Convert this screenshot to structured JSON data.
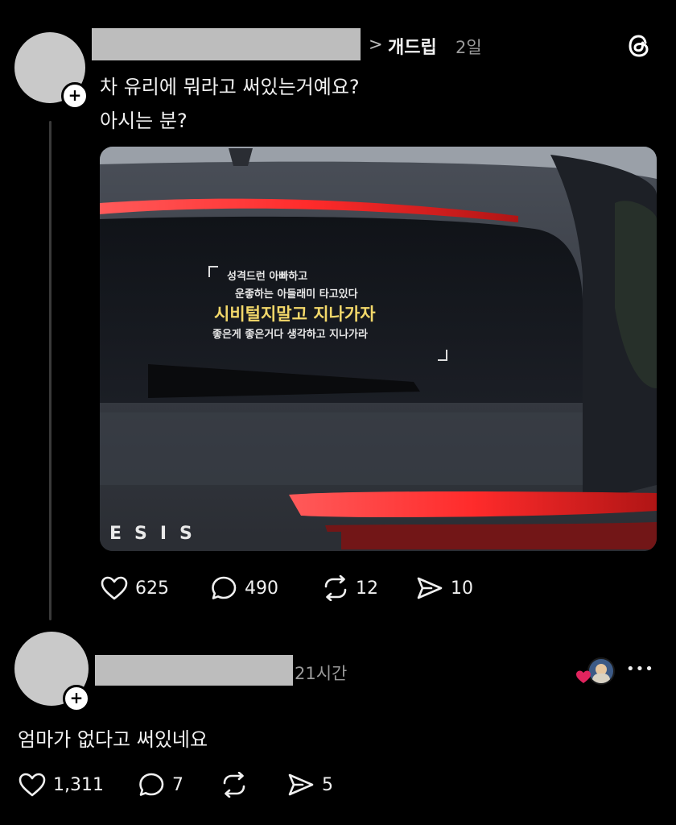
{
  "post": {
    "breadcrumb_sep": ">",
    "community": "개드립",
    "time": "2일",
    "text_line1": "차 유리에 뭐라고 써있는거예요?",
    "text_line2": "아시는 분?",
    "image": {
      "decal_line1": "성격드런 아빠하고",
      "decal_line2": "운좋하는 아들래미 타고있다",
      "decal_line3": "시비털지말고 지나가자",
      "decal_line4": "좋은게 좋은거다 생각하고 지나가라",
      "badge_text": "ESIS"
    },
    "likes": "625",
    "comments": "490",
    "reposts": "12",
    "shares": "10"
  },
  "reply": {
    "time": "21시간",
    "text": "엄마가 없다고 써있네요",
    "likes": "1,311",
    "comments": "7",
    "shares": "5",
    "more": "•••"
  },
  "avatar_plus": "+",
  "colors": {
    "background": "#000000",
    "like_heart": "#e0245e"
  },
  "icons": [
    "threads-logo-icon",
    "heart-icon",
    "comment-icon",
    "repost-icon",
    "share-icon",
    "more-icon"
  ]
}
